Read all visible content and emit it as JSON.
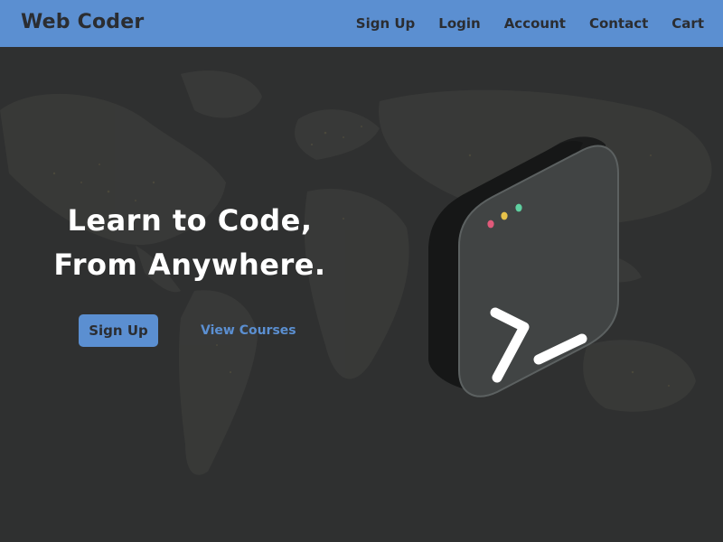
{
  "navbar": {
    "brand": "Web Coder",
    "links": [
      {
        "label": "Sign Up"
      },
      {
        "label": "Login"
      },
      {
        "label": "Account"
      },
      {
        "label": "Contact"
      },
      {
        "label": "Cart"
      }
    ]
  },
  "hero": {
    "headline_line1": "Learn to Code,",
    "headline_line2": "From Anywhere.",
    "primary_button": "Sign Up",
    "secondary_link": "View Courses",
    "illustration_icon": "terminal-icon",
    "illustration_dots": [
      "#e05a7a",
      "#e7c24a",
      "#5fd0a0"
    ]
  },
  "colors": {
    "nav_background": "#5b8fd1",
    "accent": "#5b8fd1",
    "hero_background": "#2f3030",
    "text_dark": "#2b2d31",
    "text_light": "#ffffff"
  }
}
